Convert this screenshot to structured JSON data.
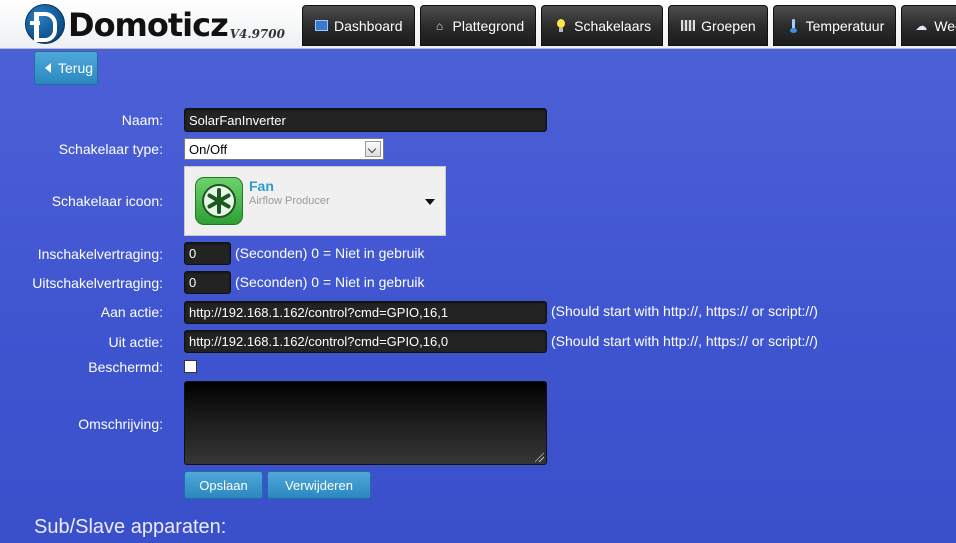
{
  "header": {
    "app_name": "Domoticz",
    "version": "V4.9700",
    "nav": [
      {
        "label": "Dashboard",
        "icon": "dashboard-icon"
      },
      {
        "label": "Plattegrond",
        "icon": "home-icon"
      },
      {
        "label": "Schakelaars",
        "icon": "lightbulb-icon"
      },
      {
        "label": "Groepen",
        "icon": "film-icon"
      },
      {
        "label": "Temperatuur",
        "icon": "thermometer-icon"
      },
      {
        "label": "Weer",
        "icon": "weather-icon"
      }
    ]
  },
  "back_button": {
    "label": "Terug"
  },
  "form": {
    "name": {
      "label": "Naam:",
      "value": "SolarFanInverter"
    },
    "switch_type": {
      "label": "Schakelaar type:",
      "value": "On/Off"
    },
    "switch_icon": {
      "label": "Schakelaar icoon:",
      "title": "Fan",
      "subtitle": "Airflow Producer"
    },
    "on_delay": {
      "label": "Inschakelvertraging:",
      "value": "0",
      "hint": "(Seconden) 0 = Niet in gebruik"
    },
    "off_delay": {
      "label": "Uitschakelvertraging:",
      "value": "0",
      "hint": "(Seconden) 0 = Niet in gebruik"
    },
    "on_action": {
      "label": "Aan actie:",
      "value": "http://192.168.1.162/control?cmd=GPIO,16,1",
      "hint": "(Should start with http://, https:// or script://)"
    },
    "off_action": {
      "label": "Uit actie:",
      "value": "http://192.168.1.162/control?cmd=GPIO,16,0",
      "hint": "(Should start with http://, https:// or script://)"
    },
    "protected": {
      "label": "Beschermd:",
      "checked": false
    },
    "description": {
      "label": "Omschrijving:",
      "value": ""
    },
    "save_label": "Opslaan",
    "delete_label": "Verwijderen"
  },
  "sub_devices": {
    "title": "Sub/Slave apparaten:"
  },
  "colors": {
    "accent": "#2a87c0",
    "background": "#4258d2",
    "nav": "#2a2a2a"
  }
}
